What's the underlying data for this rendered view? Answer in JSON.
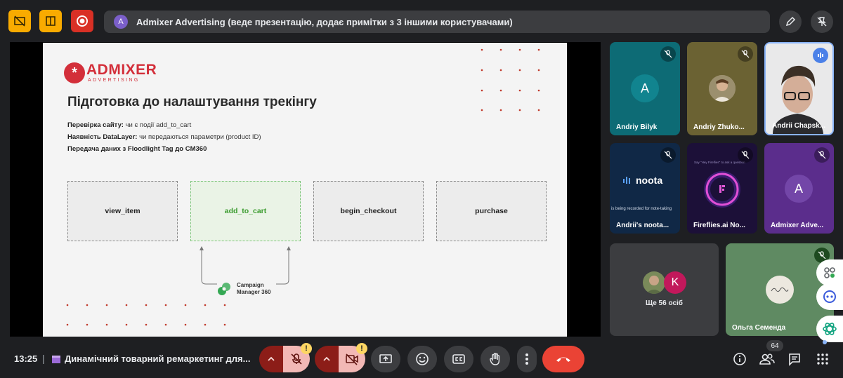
{
  "presenter_bar": {
    "avatar_letter": "A",
    "text": "Admixer Advertising (веде презентацію, додає примітки з 3 іншими користувачами)"
  },
  "slide": {
    "logo_name": "ADMIXER",
    "logo_sub": "ADVERTISING",
    "logo_mark": "*",
    "title": "Підготовка до налаштування трекінгу",
    "lines": [
      {
        "bold": "Перевірка сайту:",
        "text": " чи є події add_to_cart"
      },
      {
        "bold": "Наявність DataLayer:",
        "text": " чи передаються параметри (product ID)"
      },
      {
        "bold": "Передача даних з Floodlight Tag до CM360",
        "text": ""
      }
    ],
    "steps": [
      "view_item",
      "add_to_cart",
      "begin_checkout",
      "purchase"
    ],
    "cm_label_1": "Campaign",
    "cm_label_2": "Manager 360"
  },
  "participants": [
    {
      "name": "Andriy Bilyk",
      "letter": "A",
      "bg": "#0d6b75",
      "avatar_bg": "#11848f"
    },
    {
      "name": "Andriy Zhuko...",
      "bg": "#6b6233"
    },
    {
      "name": "Andrii Chapsk...",
      "bg": "#e9e9ea"
    },
    {
      "name": "Andrii's noota...",
      "bg": "#102846",
      "app_name": "noota",
      "caption": "is being recorded for note-taking"
    },
    {
      "name": "Fireflies.ai No...",
      "bg": "#1c1038",
      "caption": "Say \"Hey Fireflies\" to ask a question"
    },
    {
      "name": "Admixer Adve...",
      "letter": "A",
      "bg": "#5b2d8c",
      "avatar_bg": "#7346a8"
    },
    {
      "name": "Ще 56 осіб",
      "letter": "K",
      "bg": "#3c3d40"
    },
    {
      "name": "Ольга Семенда",
      "bg": "#5f8a62"
    }
  ],
  "bottom": {
    "time": "13:25",
    "separator": "|",
    "meeting_title": "Динамічний товарний ремаркетинг для...",
    "warning_mark": "!",
    "participant_count": "64"
  },
  "colors": {
    "brand_red": "#d32f3a",
    "end_call": "#ea4335",
    "muted_red": "#8c1d18",
    "warning_yellow": "#fdd663",
    "top_yellow": "#f9ab00",
    "top_red": "#d93025"
  }
}
